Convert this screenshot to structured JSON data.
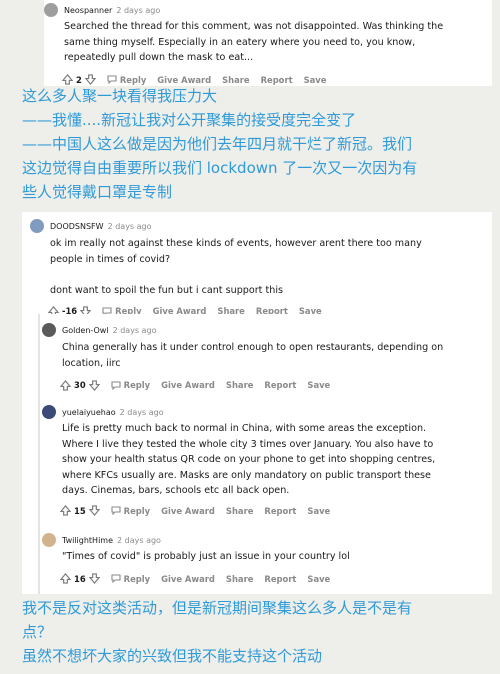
{
  "colors": {
    "background": "#eeeeea",
    "overlay_text": "#2e9bd8",
    "meta_text": "#8a8a8a"
  },
  "comments": [
    {
      "username": "Neospanner",
      "time": "2 days ago",
      "avatar_color": "#9e9e9e",
      "text": "Searched the thread for this comment, was not disappointed. Was thinking the\nsame thing myself. Especially in an eatery where you need to, you know,\nrepeatedly pull down the mask to eat...",
      "votes": "2"
    },
    {
      "username": "DOODSNSFW",
      "time": "2 days ago",
      "avatar_color": "#7f9bbf",
      "text": "ok im really not against these kinds of events, however arent there too many\npeople in times of covid?\n\ndont want to spoil the fun but i cant support this",
      "votes": "-16"
    },
    {
      "username": "Golden-Owl",
      "time": "2 days ago",
      "avatar_color": "#5a5a5a",
      "text": "China generally has it under control enough to open restaurants, depending on\nlocation, iirc",
      "votes": "30"
    },
    {
      "username": "yuelaiyuehao",
      "time": "2 days ago",
      "avatar_color": "#3b4a78",
      "text": "Life is pretty much back to normal in China, with some areas the exception.\nWhere I live they tested the whole city 3 times over January. You also have to\nshow your health status QR code on your phone to get into shopping centres,\nwhere KFCs usually are. Masks are only mandatory on public transport these\ndays. Cinemas, bars, schools etc all back open.",
      "votes": "15"
    },
    {
      "username": "TwilightHime",
      "time": "2 days ago",
      "avatar_color": "#d2b48c",
      "text": "\"Times of covid\" is probably just an issue in your country lol",
      "votes": "16"
    }
  ],
  "actions": {
    "reply": "Reply",
    "give_award": "Give Award",
    "share": "Share",
    "report": "Report",
    "save": "Save"
  },
  "annotations": {
    "top": "这么多人聚一块看得我压力大\n——我懂....新冠让我对公开聚集的接受度完全变了\n——中国人这么做是因为他们去年四月就干烂了新冠。我们\n这边觉得自由重要所以我们 lockdown 了一次又一次因为有\n些人觉得戴口罩是专制",
    "bottom": "我不是反对这类活动，但是新冠期间聚集这么多人是不是有\n点？\n  虽然不想坏大家的兴致但我不能支持这个活动"
  }
}
